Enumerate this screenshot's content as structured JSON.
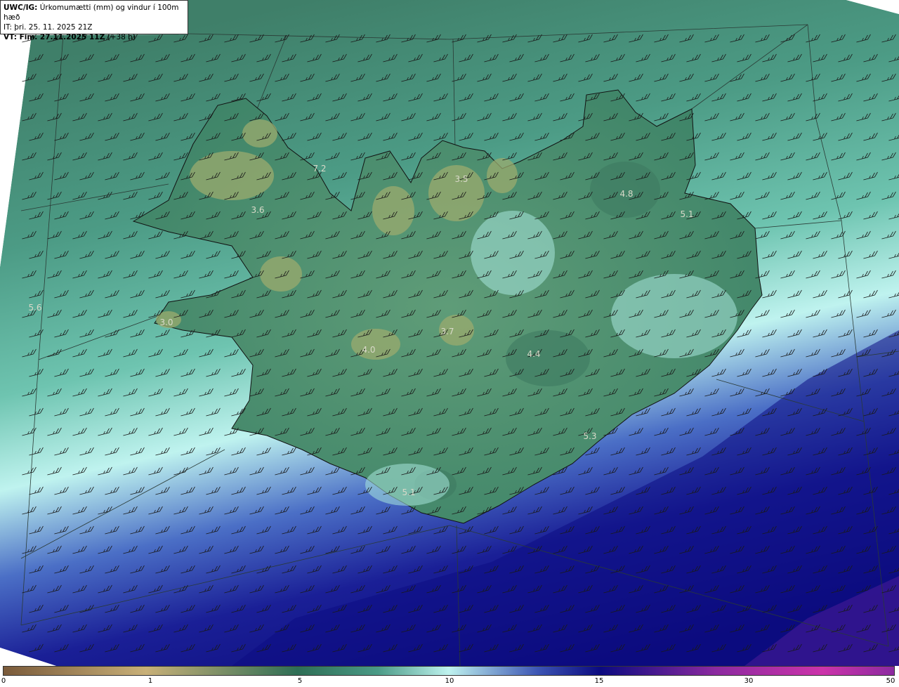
{
  "header": {
    "model": "UWC/IG:",
    "title": "Úrkomumætti (mm) og vindur í 100m hæð",
    "init_time": "IT: þri. 25. 11. 2025 21Z",
    "valid_prefix": "VT: Fim. 27.11.2025 11Z",
    "valid_suffix": "(+38 h)"
  },
  "values": [
    {
      "label": "7.2"
    },
    {
      "label": "3.6"
    },
    {
      "label": "3.5"
    },
    {
      "label": "4.8"
    },
    {
      "label": "5.1"
    },
    {
      "label": "5.6"
    },
    {
      "label": "3.0"
    },
    {
      "label": "4.0"
    },
    {
      "label": "3.7"
    },
    {
      "label": "4.4"
    },
    {
      "label": "5.3"
    },
    {
      "label": "5.1"
    }
  ],
  "colorbar": {
    "ticks": [
      "0",
      "1",
      "5",
      "10",
      "15",
      "30",
      "50"
    ],
    "colors": {
      "brown": "#7a5a3a",
      "tan": "#c8b078",
      "green": "#2e6e55",
      "teal": "#4a9a86",
      "cyan": "#bff3ef",
      "blue": "#3c55b4",
      "navy": "#0b0a80",
      "purple": "#8c2aa0",
      "magenta": "#cc33aa"
    }
  }
}
